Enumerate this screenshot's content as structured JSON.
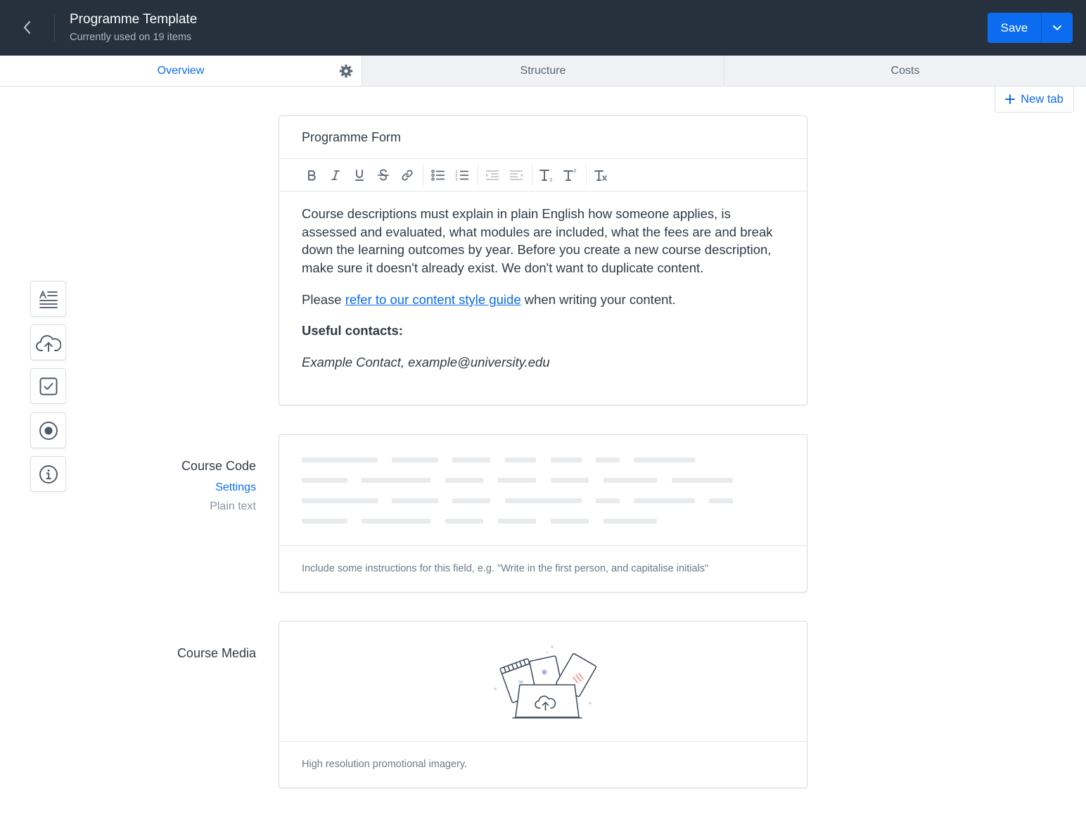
{
  "header": {
    "title": "Programme Template",
    "subtitle": "Currently used on 19 items",
    "save_label": "Save"
  },
  "tabs": [
    {
      "label": "Overview",
      "active": true
    },
    {
      "label": "Structure",
      "active": false
    },
    {
      "label": "Costs",
      "active": false
    }
  ],
  "new_tab_label": "New tab",
  "side_tools": [
    "text-block-icon",
    "cloud-upload-icon",
    "checkbox-icon",
    "radio-icon",
    "info-icon"
  ],
  "programme_form": {
    "title": "Programme Form",
    "toolbar": [
      "bold",
      "italic",
      "underline",
      "strikethrough",
      "link",
      "bullet-list",
      "numbered-list",
      "indent",
      "outdent",
      "subscript",
      "superscript",
      "clear-format"
    ],
    "paragraph1": "Course descriptions must explain in plain English how someone applies, is assessed and evaluated, what modules are included, what the fees are and break down the learning outcomes by year. Before you create a new course description, make sure it doesn't already exist. We don't want to duplicate content.",
    "p2_before": "Please ",
    "p2_link": "refer to our content style guide",
    "p2_after": " when writing your content.",
    "contacts_heading": "Useful contacts:",
    "contact_line": "Example Contact, example@university.edu"
  },
  "course_code": {
    "label": "Course Code",
    "settings_link": "Settings",
    "type": "Plain text",
    "hint": "Include some instructions for this field, e.g. \"Write in the first person, and capitalise initials\""
  },
  "course_media": {
    "label": "Course Media",
    "hint": "High resolution promotional imagery."
  },
  "colors": {
    "header_bg": "#27313d",
    "accent": "#0b6cf0",
    "tab_inactive_bg": "#f0f2f5",
    "border": "#d9dde2"
  }
}
